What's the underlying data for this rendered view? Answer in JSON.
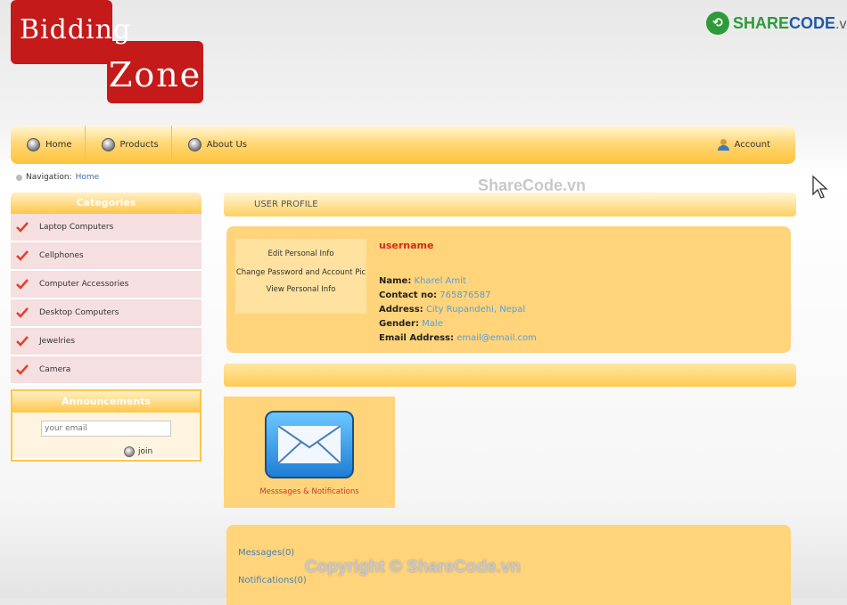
{
  "logo": {
    "line1": "Bidding",
    "line2": "Zone"
  },
  "brand": {
    "icon": "share-icon",
    "name_main": "SHARE",
    "name_rest": "CODE",
    "tld": ".vn"
  },
  "nav": {
    "items": [
      {
        "label": "Home",
        "icon": "globe-icon"
      },
      {
        "label": "Products",
        "icon": "globe-icon"
      },
      {
        "label": "About Us",
        "icon": "globe-icon"
      }
    ],
    "account": {
      "label": "Account",
      "icon": "user-icon"
    }
  },
  "breadcrumb": {
    "label": "Navigation:",
    "current": "Home"
  },
  "watermark": {
    "top": "ShareCode.vn",
    "bottom": "Copyright © ShareCode.vn"
  },
  "categories": {
    "title": "Categories",
    "items": [
      {
        "label": "Laptop Computers"
      },
      {
        "label": "Cellphones"
      },
      {
        "label": "Computer Accessories"
      },
      {
        "label": "Desktop Computers"
      },
      {
        "label": "Jewelries"
      },
      {
        "label": "Camera"
      }
    ]
  },
  "announcements": {
    "title": "Announcements",
    "email_placeholder": "your email",
    "join_label": "join"
  },
  "profile": {
    "header": "USER PROFILE",
    "menu": [
      "Edit Personal Info",
      "Change Password and Account Pic",
      "View Personal Info"
    ],
    "username": "username",
    "fields": [
      {
        "label": "Name:",
        "value": "Kharel Amit"
      },
      {
        "label": "Contact no:",
        "value": "765876587"
      },
      {
        "label": "Address:",
        "value": "City Rupandehi, Nepal"
      },
      {
        "label": "Gender:",
        "value": "Male"
      },
      {
        "label": "Email Address:",
        "value": "email@email.com"
      }
    ]
  },
  "messages": {
    "tile_label": "Messsages & Notifications",
    "messages_link": "Messages(0)",
    "notifications_link": "Notifications(0)"
  },
  "colors": {
    "accent": "#ffc23a",
    "logo_red": "#c41a1a",
    "link_blue": "#5a9fd8"
  }
}
